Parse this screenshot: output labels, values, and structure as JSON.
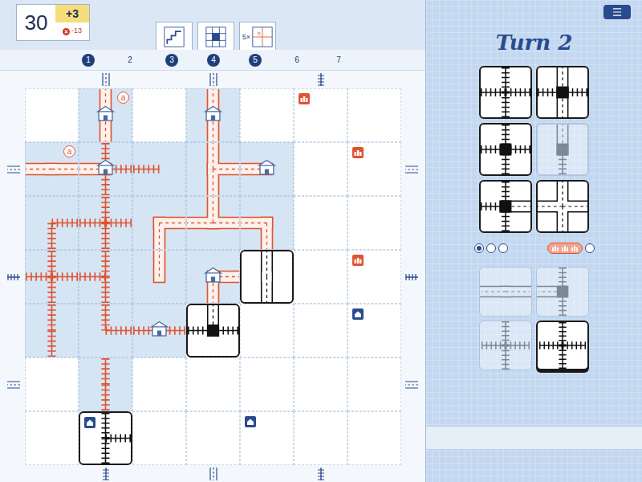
{
  "score": {
    "total": "30",
    "bonus": "+3",
    "penalty": "-13"
  },
  "rounds": [
    {
      "label": "1",
      "filled": true,
      "special": null
    },
    {
      "label": "2",
      "filled": false,
      "special": null
    },
    {
      "label": "3",
      "filled": true,
      "special": {
        "kind": "stairs",
        "text": ""
      }
    },
    {
      "label": "4",
      "filled": true,
      "special": {
        "kind": "grid",
        "text": ""
      }
    },
    {
      "label": "5",
      "filled": true,
      "special": {
        "kind": "multiplier",
        "text": "5×"
      }
    },
    {
      "label": "6",
      "filled": false,
      "special": null
    },
    {
      "label": "7",
      "filled": false,
      "special": null
    }
  ],
  "board": {
    "tiles": [
      {
        "row": 0,
        "col": 1,
        "road": [
          "n",
          "s"
        ],
        "rail": [],
        "station": true,
        "current": false,
        "label": "a"
      },
      {
        "row": 0,
        "col": 3,
        "road": [
          "n",
          "s"
        ],
        "rail": [],
        "station": true,
        "current": false,
        "label": ""
      },
      {
        "row": 1,
        "col": 0,
        "road": [
          "w",
          "e"
        ],
        "rail": [],
        "station": false,
        "current": false,
        "label": "a"
      },
      {
        "row": 1,
        "col": 1,
        "road": [
          "w"
        ],
        "rail": [
          "n",
          "s",
          "e"
        ],
        "station": true,
        "current": false,
        "label": ""
      },
      {
        "row": 1,
        "col": 2,
        "road": [],
        "rail": [
          "w"
        ],
        "station": false,
        "current": false,
        "label": ""
      },
      {
        "row": 1,
        "col": 3,
        "road": [
          "n",
          "s",
          "e"
        ],
        "rail": [],
        "station": false,
        "current": false,
        "label": ""
      },
      {
        "row": 1,
        "col": 4,
        "road": [
          "w"
        ],
        "rail": [],
        "station": true,
        "current": false,
        "label": ""
      },
      {
        "row": 2,
        "col": 0,
        "road": [],
        "rail": [
          "s",
          "e"
        ],
        "station": false,
        "current": false,
        "label": ""
      },
      {
        "row": 2,
        "col": 1,
        "road": [],
        "rail": [
          "n",
          "s",
          "w",
          "e"
        ],
        "station": false,
        "current": false,
        "label": ""
      },
      {
        "row": 2,
        "col": 2,
        "road": [
          "e",
          "s"
        ],
        "rail": [],
        "station": false,
        "current": false,
        "label": ""
      },
      {
        "row": 2,
        "col": 3,
        "road": [
          "n",
          "w",
          "e"
        ],
        "rail": [],
        "station": false,
        "current": false,
        "label": ""
      },
      {
        "row": 2,
        "col": 4,
        "road": [
          "w",
          "s"
        ],
        "rail": [],
        "station": false,
        "current": false,
        "label": ""
      },
      {
        "row": 3,
        "col": 0,
        "road": [],
        "rail": [
          "w",
          "e",
          "n",
          "s"
        ],
        "station": false,
        "current": false,
        "label": ""
      },
      {
        "row": 3,
        "col": 1,
        "road": [],
        "rail": [
          "w",
          "n",
          "s"
        ],
        "station": false,
        "current": false,
        "label": ""
      },
      {
        "row": 3,
        "col": 2,
        "road": [
          "n"
        ],
        "rail": [],
        "station": false,
        "current": false,
        "label": ""
      },
      {
        "row": 3,
        "col": 3,
        "road": [
          "e",
          "s"
        ],
        "rail": [],
        "station": true,
        "current": false,
        "label": ""
      },
      {
        "row": 3,
        "col": 4,
        "road": [
          "n",
          "s"
        ],
        "rail": [],
        "station": false,
        "current": true,
        "label": ""
      },
      {
        "row": 4,
        "col": 0,
        "road": [],
        "rail": [
          "n",
          "s"
        ],
        "station": false,
        "current": false,
        "label": ""
      },
      {
        "row": 4,
        "col": 1,
        "road": [],
        "rail": [
          "n",
          "e"
        ],
        "station": false,
        "current": false,
        "label": ""
      },
      {
        "row": 4,
        "col": 2,
        "road": [],
        "rail": [
          "w",
          "e"
        ],
        "station": true,
        "current": false,
        "label": ""
      },
      {
        "row": 4,
        "col": 3,
        "road": [
          "n"
        ],
        "rail": [
          "w",
          "e"
        ],
        "station": true,
        "current": true,
        "label": ""
      },
      {
        "row": 5,
        "col": 1,
        "road": [],
        "rail": [
          "n",
          "s"
        ],
        "station": false,
        "current": false,
        "label": ""
      },
      {
        "row": 6,
        "col": 1,
        "road": [],
        "rail": [
          "n",
          "s",
          "e"
        ],
        "station": false,
        "current": true,
        "label": ""
      }
    ],
    "markers": [
      {
        "row": 0,
        "col": 5,
        "kind": "landmark",
        "color": "#e0532f"
      },
      {
        "row": 1,
        "col": 6,
        "kind": "landmark",
        "color": "#e0532f"
      },
      {
        "row": 3,
        "col": 6,
        "kind": "landmark",
        "color": "#e0532f"
      },
      {
        "row": 4,
        "col": 6,
        "kind": "house",
        "color": "#2a4a8f"
      },
      {
        "row": 6,
        "col": 4,
        "kind": "house",
        "color": "#2a4a8f"
      },
      {
        "row": 6,
        "col": 1,
        "kind": "house",
        "color": "#2a4a8f"
      }
    ],
    "exits": [
      {
        "side": "top",
        "index": 1,
        "kind": "road"
      },
      {
        "side": "top",
        "index": 3,
        "kind": "road"
      },
      {
        "side": "top",
        "index": 5,
        "kind": "rail"
      },
      {
        "side": "left",
        "index": 1,
        "kind": "road"
      },
      {
        "side": "left",
        "index": 3,
        "kind": "rail"
      },
      {
        "side": "left",
        "index": 5,
        "kind": "road"
      },
      {
        "side": "right",
        "index": 1,
        "kind": "road"
      },
      {
        "side": "right",
        "index": 3,
        "kind": "rail"
      },
      {
        "side": "right",
        "index": 5,
        "kind": "road"
      },
      {
        "side": "bottom",
        "index": 1,
        "kind": "rail"
      },
      {
        "side": "bottom",
        "index": 3,
        "kind": "road"
      },
      {
        "side": "bottom",
        "index": 5,
        "kind": "rail"
      }
    ]
  },
  "sidebar": {
    "title": "Turn 2",
    "dice": [
      {
        "road": [],
        "rail": [
          "n",
          "s",
          "e",
          "w"
        ],
        "station": false,
        "used": false
      },
      {
        "road": [
          "n",
          "s"
        ],
        "rail": [
          "w",
          "e"
        ],
        "station": true,
        "used": false
      },
      {
        "road": [],
        "rail": [
          "n",
          "s",
          "w",
          "e"
        ],
        "station": true,
        "used": false
      },
      {
        "road": [
          "n"
        ],
        "rail": [
          "s"
        ],
        "station": true,
        "used": true
      },
      {
        "road": [
          "e"
        ],
        "rail": [
          "n",
          "s",
          "w"
        ],
        "station": true,
        "used": false
      },
      {
        "road": [
          "n",
          "s",
          "w",
          "e"
        ],
        "rail": [],
        "station": false,
        "used": false
      }
    ],
    "progress": [
      {
        "selected": true
      },
      {
        "selected": false
      },
      {
        "selected": false
      }
    ],
    "bonus_track": [
      {
        "used": true
      },
      {
        "used": true
      },
      {
        "used": true
      },
      {
        "used": false
      }
    ],
    "specials": [
      {
        "road": [
          "w",
          "e"
        ],
        "rail": [],
        "station": false,
        "available": false,
        "selected": false
      },
      {
        "road": [
          "w"
        ],
        "rail": [
          "n",
          "s"
        ],
        "station": true,
        "available": false,
        "selected": false
      },
      {
        "road": [],
        "rail": [
          "n",
          "s",
          "w",
          "e"
        ],
        "station": false,
        "available": false,
        "selected": false
      },
      {
        "road": [],
        "rail": [
          "n",
          "s",
          "w",
          "e"
        ],
        "station": false,
        "available": true,
        "selected": true
      }
    ]
  }
}
